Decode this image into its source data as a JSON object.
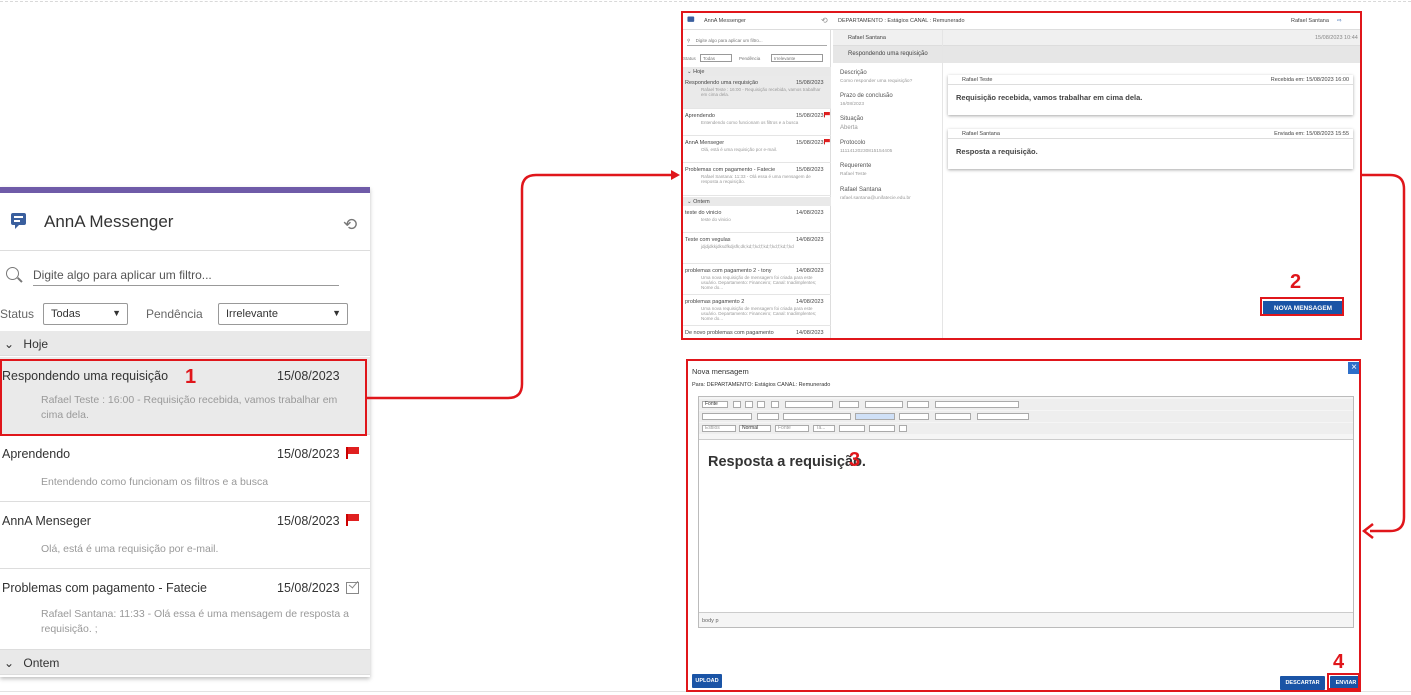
{
  "left_panel": {
    "app_title": "AnnA Messenger",
    "icons": {
      "app": "chat-bubble-icon",
      "refresh": "refresh-icon",
      "search": "search-icon"
    },
    "search_placeholder": "Digite algo para aplicar um filtro...",
    "status_label": "Status",
    "status_value": "Todas",
    "pendencia_label": "Pendência",
    "pendencia_value": "Irrelevante",
    "group_today": "Hoje",
    "group_yesterday": "Ontem",
    "items": [
      {
        "title": "Respondendo uma requisição",
        "date": "15/08/2023",
        "preview": "Rafael Teste : 16:00 - Requisição recebida, vamos trabalhar em cima dela.",
        "icon": "none"
      },
      {
        "title": "Aprendendo",
        "date": "15/08/2023",
        "preview": "Entendendo como funcionam os filtros e a busca",
        "icon": "flag-icon"
      },
      {
        "title": "AnnA Menseger",
        "date": "15/08/2023",
        "preview": "Olá, está é uma requisição por e-mail.",
        "icon": "flag-icon"
      },
      {
        "title": "Problemas com pagamento - Fatecie",
        "date": "15/08/2023",
        "preview": "Rafael Santana: 11:33 - Olá essa é uma mensagem de resposta a requisição. ;",
        "icon": "done-icon"
      }
    ]
  },
  "annotations": {
    "n1": "1",
    "n2": "2",
    "n3": "3",
    "n4": "4"
  },
  "shot": {
    "app_title": "AnnA Messenger",
    "context": "DEPARTAMENTO : Estágios    CANAL : Remunerado",
    "user": "Rafael Santana",
    "search_placeholder": "Digite algo para aplicar um filtro...",
    "status_label": "Status",
    "status_value": "Todas",
    "pend_label": "Pendência",
    "pend_value": "Irrelevante",
    "group_today": "Hoje",
    "group_yesterday": "Ontem",
    "items": [
      {
        "title": "Respondendo uma requisição",
        "date": "15/08/2023",
        "preview": "Rafael Teste : 16:00 - Requisição recebida, vamos trabalhar em cima dela."
      },
      {
        "title": "Aprendendo",
        "date": "15/08/2023",
        "preview": "Entendendo como funcionam os filtros e a busca"
      },
      {
        "title": "AnnA Menseger",
        "date": "15/08/2023",
        "preview": "Olá, está é uma requisição por e-mail."
      },
      {
        "title": "Problemas com pagamento - Fatecie",
        "date": "15/08/2023",
        "preview": "Rafael Santana: 11:33 - Olá essa é uma mensagem de resposta a requisição."
      },
      {
        "title": "teste do vinicio",
        "date": "14/08/2023",
        "preview": "teste do vinicio"
      },
      {
        "title": "Teste com vegulas",
        "date": "14/08/2023",
        "preview": "jdjdjdkkjdksdfkdjsfk;dk;kd;f;kd;f;kd;f;kd;f;kd;f;kd"
      },
      {
        "title": "problemas com pagamento 2 - tony",
        "date": "14/08/2023",
        "preview": "Uma nova requisição de mensagem foi criada para este usuário. Departamento: Financeiro; Canal: Inadimplentes; Nome do..."
      },
      {
        "title": "problemas pagamento 2",
        "date": "14/08/2023",
        "preview": "Uma nova requisição de mensagem foi criada para este usuário. Departamento: Financeiro; Canal: Inadimplentes; Nome do..."
      },
      {
        "title": "De novo problemas com pagamento",
        "date": "14/08/2023",
        "preview": ""
      }
    ],
    "header_name": "Rafael Santana",
    "header_date": "15/08/2023 10:44",
    "subject": "Respondendo uma requisição",
    "details": [
      {
        "k": "Descrição",
        "v": "Como responder uma requisição?"
      },
      {
        "k": "Prazo de conclusão",
        "v": "16/08/2023"
      },
      {
        "k": "Situação",
        "v": "Aberta"
      },
      {
        "k": "Protocolo",
        "v": "11114120230815154405"
      },
      {
        "k": "Requerente",
        "v": "Rafael Teste"
      },
      {
        "k": "Rafael Santana",
        "v": "rafael.santana@unifatecie.edu.br"
      }
    ],
    "msg1": {
      "author": "Rafael Teste",
      "stamp": "Recebida em: 15/08/2023 16:00",
      "text": "Requisição recebida, vamos trabalhar em cima dela."
    },
    "msg2": {
      "author": "Rafael Santana",
      "stamp": "Enviada em: 15/08/2023 15:55",
      "text": "Resposta a requisição."
    },
    "new_message_btn": "NOVA MENSAGEM"
  },
  "editor": {
    "title": "Nova mensagem",
    "to": "Para: DEPARTAMENTO: Estágios CANAL: Remunerado",
    "close": "×",
    "tb1": "Fonte",
    "style_sel": "Estilos",
    "format_sel": "Normal",
    "font_sel": "Fonte",
    "size_sel": "Ta...",
    "body": "Resposta a requisição.",
    "path": "body p",
    "upload_btn": "UPLOAD",
    "discard_btn": "DESCARTAR",
    "send_btn": "ENVIAR"
  }
}
